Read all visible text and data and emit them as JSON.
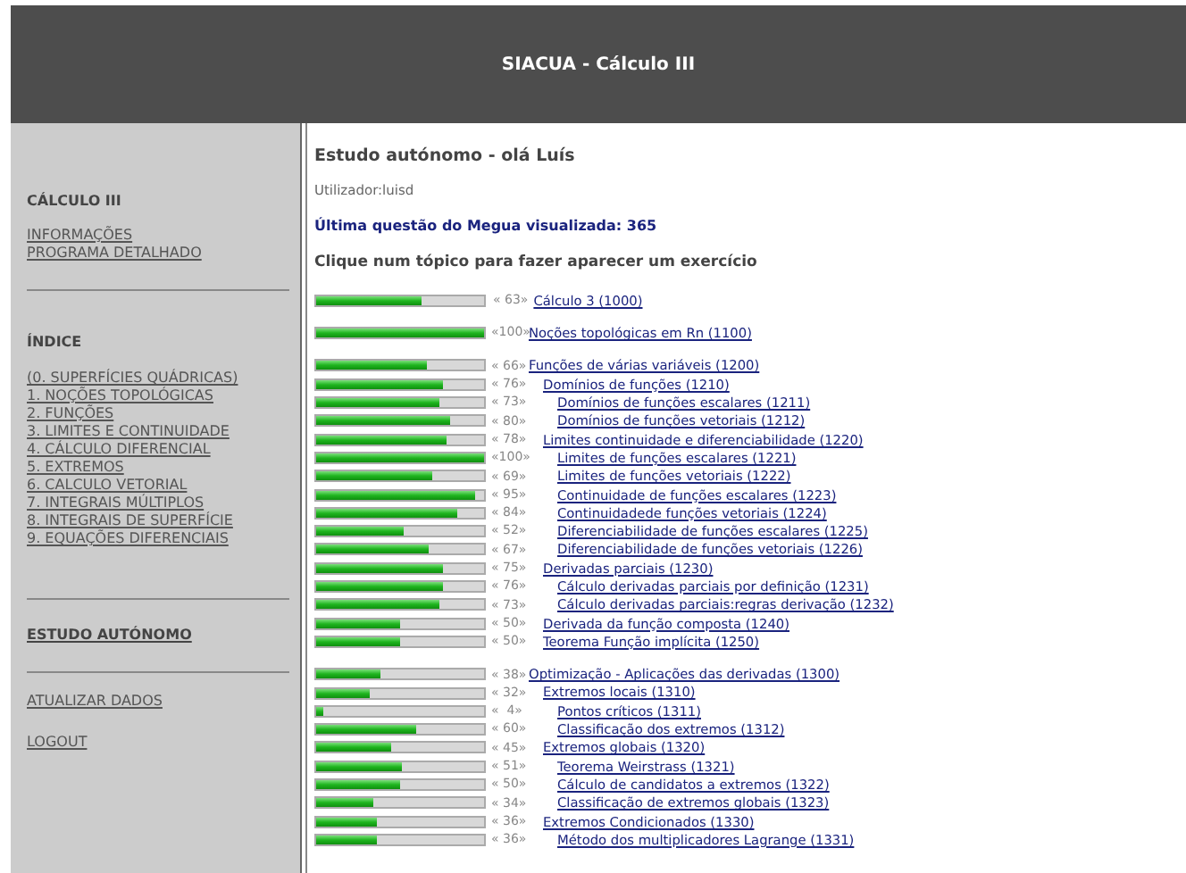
{
  "header": {
    "title": "SIACUA - Cálculo III"
  },
  "sidebar": {
    "course": "CÁLCULO III",
    "course_links": [
      "INFORMAÇÕES",
      "PROGRAMA DETALHADO"
    ],
    "index_title": "ÍNDICE",
    "index_links": [
      "(0. SUPERFÍCIES QUÁDRICAS)",
      "1. NOÇÕES TOPOLÓGICAS",
      "2. FUNÇÕES",
      "3. LIMITES E CONTINUIDADE",
      "4. CÁLCULO DIFERENCIAL",
      "5. EXTREMOS",
      "6. CALCULO VETORIAL",
      "7. INTEGRAIS MÚLTIPLOS",
      "8. INTEGRAIS DE SUPERFÍCIE",
      "9. EQUAÇÕES DIFERENCIAIS"
    ],
    "study_link": "ESTUDO AUTÓNOMO",
    "bottom_links": [
      "ATUALIZAR DADOS",
      "LOGOUT"
    ]
  },
  "main": {
    "title": "Estudo autónomo - olá Luís",
    "user": "Utilizador:luisd",
    "last_question": "Última questão do Megua visualizada: 365",
    "instruction": "Clique num tópico para fazer aparecer um exercício",
    "topics": [
      {
        "label": "Cálculo 3 (1000)",
        "level": 0.63,
        "score": "« 63»"
      },
      {
        "label": "Noções topológicas em Rn (1100)",
        "level": 1.0,
        "score": "«100»"
      },
      {
        "label": "Funções de várias variáveis (1200)",
        "level": 0.66,
        "score": "« 66»",
        "children": [
          {
            "label": "Domínios de funções (1210)",
            "level": 0.76,
            "score": "« 76»",
            "children": [
              {
                "label": "Domínios de funções escalares (1211)",
                "level": 0.73,
                "score": "« 73»"
              },
              {
                "label": "Domínios de funções vetoriais (1212)",
                "level": 0.8,
                "score": "« 80»"
              }
            ]
          },
          {
            "label": "Limites continuidade e diferenciabilidade (1220)",
            "level": 0.78,
            "score": "« 78»",
            "children": [
              {
                "label": "Limites de funções escalares (1221)",
                "level": 1.0,
                "score": "«100»"
              },
              {
                "label": "Limites de funções vetoriais (1222)",
                "level": 0.69,
                "score": "« 69»"
              },
              {
                "label": "Continuidade de funções escalares (1223)",
                "level": 0.95,
                "score": "« 95»"
              },
              {
                "label": "Continuidadede funções vetoriais (1224)",
                "level": 0.84,
                "score": "« 84»"
              },
              {
                "label": "Diferenciabilidade de funções escalares (1225)",
                "level": 0.52,
                "score": "« 52»"
              },
              {
                "label": "Diferenciabilidade de funções vetoriais (1226)",
                "level": 0.67,
                "score": "« 67»"
              }
            ]
          },
          {
            "label": "Derivadas parciais (1230)",
            "level": 0.75,
            "score": "« 75»",
            "children": [
              {
                "label": "Cálculo derivadas parciais por definição (1231)",
                "level": 0.76,
                "score": "« 76»"
              },
              {
                "label": "Cálculo derivadas parciais:regras derivação (1232)",
                "level": 0.73,
                "score": "« 73»"
              }
            ]
          },
          {
            "label": "Derivada da função composta (1240)",
            "level": 0.5,
            "score": "« 50»"
          },
          {
            "label": "Teorema Função implícita (1250)",
            "level": 0.5,
            "score": "« 50»"
          }
        ]
      },
      {
        "label": "Optimização - Aplicações das derivadas (1300)",
        "level": 0.38,
        "score": "« 38»",
        "children": [
          {
            "label": "Extremos locais (1310)",
            "level": 0.32,
            "score": "« 32»",
            "children": [
              {
                "label": "Pontos críticos (1311)",
                "level": 0.04,
                "score": "«  4»"
              },
              {
                "label": "Classificação dos extremos (1312)",
                "level": 0.6,
                "score": "« 60»"
              }
            ]
          },
          {
            "label": "Extremos globais (1320)",
            "level": 0.45,
            "score": "« 45»",
            "children": [
              {
                "label": "Teorema Weirstrass (1321)",
                "level": 0.51,
                "score": "« 51»"
              },
              {
                "label": "Cálculo de candidatos a extremos (1322)",
                "level": 0.5,
                "score": "« 50»"
              },
              {
                "label": "Classificação de extremos globais (1323)",
                "level": 0.34,
                "score": "« 34»"
              }
            ]
          },
          {
            "label": "Extremos Condicionados (1330)",
            "level": 0.36,
            "score": "« 36»",
            "children": [
              {
                "label": "Método dos multiplicadores Lagrange (1331)",
                "level": 0.36,
                "score": "« 36»"
              }
            ]
          }
        ]
      }
    ]
  }
}
